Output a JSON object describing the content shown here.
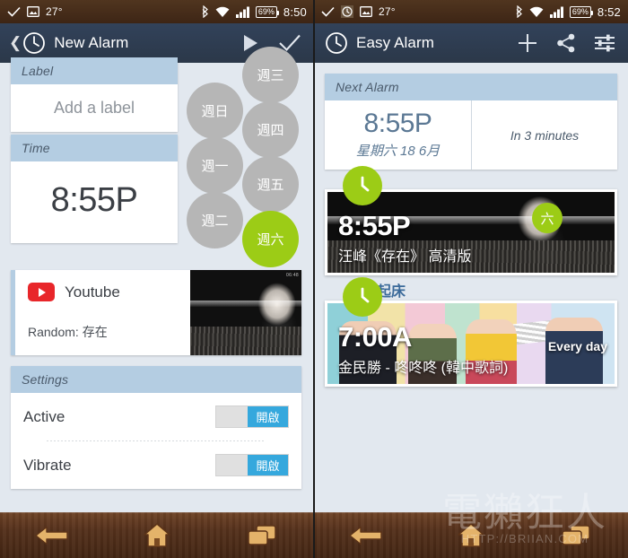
{
  "left": {
    "statusbar": {
      "temp": "27°",
      "battery": "69%",
      "time": "8:50"
    },
    "appbar": {
      "title": "New Alarm",
      "back_chevron": "❮"
    },
    "label_card": {
      "header": "Label",
      "placeholder": "Add a label"
    },
    "time_card": {
      "header": "Time",
      "value": "8:55P"
    },
    "days": [
      {
        "label": "週日",
        "active": false
      },
      {
        "label": "週一",
        "active": false
      },
      {
        "label": "週二",
        "active": false
      },
      {
        "label": "週三",
        "active": false
      },
      {
        "label": "週四",
        "active": false
      },
      {
        "label": "週五",
        "active": false
      },
      {
        "label": "週六",
        "active": true
      }
    ],
    "youtube_card": {
      "source": "Youtube",
      "detail": "Random: 存在",
      "thumb_stamp": "06:48"
    },
    "settings": {
      "header": "Settings",
      "rows": [
        {
          "name": "Active",
          "toggle": "開啟"
        },
        {
          "name": "Vibrate",
          "toggle": "開啟"
        }
      ]
    }
  },
  "right": {
    "statusbar": {
      "temp": "27°",
      "battery": "69%",
      "time": "8:52"
    },
    "appbar": {
      "title": "Easy Alarm"
    },
    "next_alarm": {
      "header": "Next Alarm",
      "time": "8:55P",
      "date": "星期六 18 6月",
      "countdown": "In 3 minutes"
    },
    "alarms": [
      {
        "title": "",
        "time": "8:55P",
        "subtitle": "汪峰《存在》 高清版",
        "repeat_badge": "六",
        "repeat_text": ""
      },
      {
        "title": "起床",
        "time": "7:00A",
        "subtitle": "金民勝 - 咚咚咚 (韓中歌詞)",
        "repeat_badge": "",
        "repeat_text": "Every day"
      }
    ]
  },
  "navbar": {
    "back": "back-arrow",
    "home": "home",
    "recents": "recent-apps"
  },
  "watermark": {
    "line1": "電獺狂人",
    "line2": "HTTP://BRIIAN.COM"
  },
  "colors": {
    "accent_green": "#9ccc16",
    "toggle_on": "#35a8dd",
    "card_header": "#b4cde2",
    "appbar": "#32425a"
  }
}
